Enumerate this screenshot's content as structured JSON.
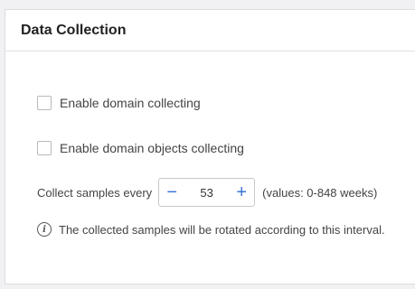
{
  "card": {
    "title": "Data Collection"
  },
  "options": {
    "domain_collecting": {
      "label": "Enable domain collecting",
      "checked": false
    },
    "domain_objects_collecting": {
      "label": "Enable domain objects collecting",
      "checked": false
    }
  },
  "samples": {
    "label": "Collect samples every",
    "decrement_symbol": "−",
    "increment_symbol": "+",
    "value": "53",
    "hint": "(values: 0-848 weeks)"
  },
  "info": {
    "icon": "info-icon",
    "symbol": "i",
    "text": "The collected samples will be rotated according to this interval."
  },
  "colors": {
    "accent": "#3b73d9"
  }
}
